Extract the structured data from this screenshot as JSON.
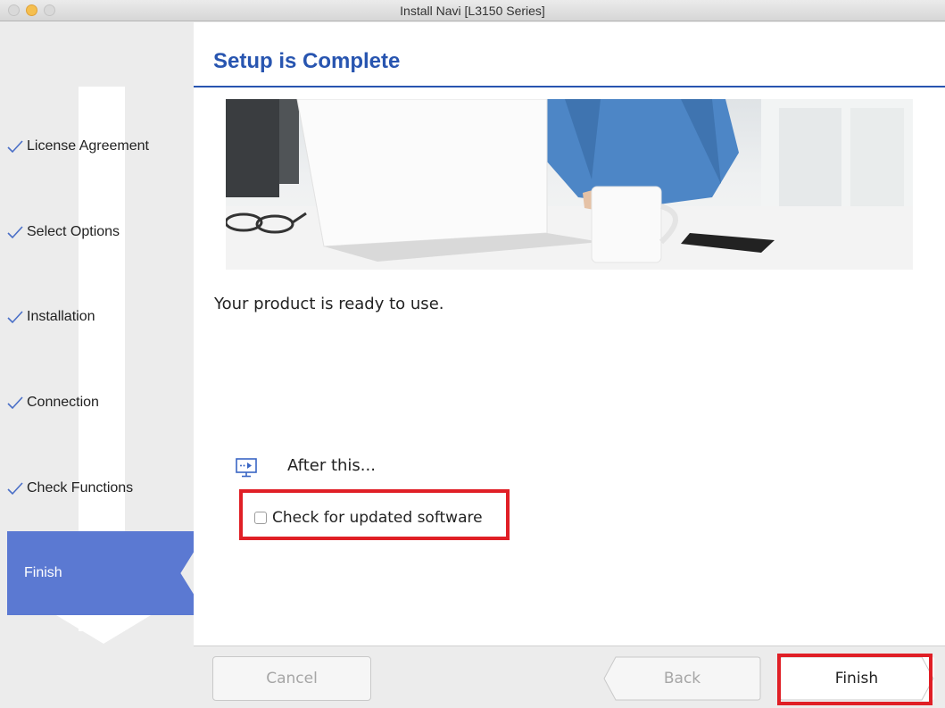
{
  "window": {
    "title": "Install Navi [L3150 Series]"
  },
  "sidebar": {
    "steps": [
      {
        "label": "License Agreement",
        "state": "done"
      },
      {
        "label": "Select Options",
        "state": "done"
      },
      {
        "label": "Installation",
        "state": "done"
      },
      {
        "label": "Connection",
        "state": "done"
      },
      {
        "label": "Check Functions",
        "state": "done"
      },
      {
        "label": "Finish",
        "state": "current"
      }
    ]
  },
  "main": {
    "heading": "Setup is Complete",
    "message": "Your product is ready to use.",
    "after_this": {
      "label": "After this...",
      "icon": "monitor-arrow-icon"
    },
    "update_checkbox": {
      "label": "Check for updated software",
      "checked": false
    }
  },
  "footer": {
    "cancel_label": "Cancel",
    "back_label": "Back",
    "finish_label": "Finish"
  },
  "colors": {
    "accent": "#2855b0",
    "active_step": "#5b79d2",
    "highlight": "#e01f26"
  }
}
